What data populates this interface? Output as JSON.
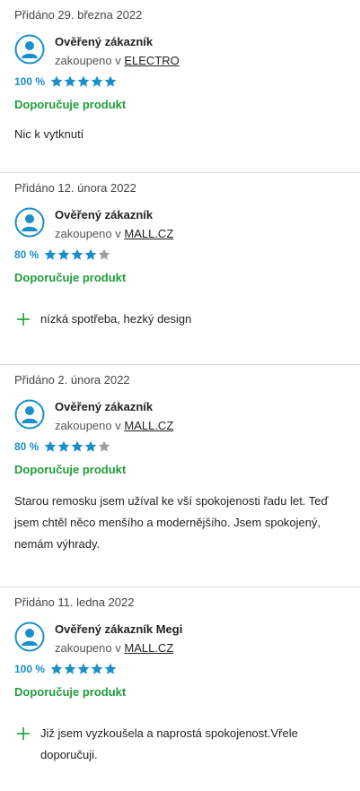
{
  "reviews": [
    {
      "date": "Přidáno 29. března 2022",
      "author": "Ověřený zákazník",
      "purchased_prefix": "zakoupeno v",
      "shop": "ELECTRO",
      "percent": "100 %",
      "rating_stars": 5,
      "recommend": "Doporučuje produkt",
      "text": "Nic k vytknutí"
    },
    {
      "date": "Přidáno 12. února 2022",
      "author": "Ověřený zákazník",
      "purchased_prefix": "zakoupeno v",
      "shop": "MALL.CZ",
      "percent": "80 %",
      "rating_stars": 4,
      "recommend": "Doporučuje produkt",
      "pro": "nízká spotřeba, hezký design"
    },
    {
      "date": "Přidáno 2. února 2022",
      "author": "Ověřený zákazník",
      "purchased_prefix": "zakoupeno v",
      "shop": "MALL.CZ",
      "percent": "80 %",
      "rating_stars": 4,
      "recommend": "Doporučuje produkt",
      "text": "Starou remosku jsem užíval ke vší spokojenosti řadu let. Teď jsem chtěl něco menšího a modernějšího. Jsem spokojený, nemám výhrady."
    },
    {
      "date": "Přidáno 11. ledna 2022",
      "author": "Ověřený zákazník Megi",
      "purchased_prefix": "zakoupeno v",
      "shop": "MALL.CZ",
      "percent": "100 %",
      "rating_stars": 5,
      "recommend": "Doporučuje produkt",
      "pro": "Již jsem vyzkoušela a naprostá spokojenost.Vřele doporučuji."
    }
  ],
  "colors": {
    "star_filled": "#1a8fc9",
    "star_empty": "#9e9e9e",
    "recommend": "#1f9d3a",
    "avatar": "#1a8fc9",
    "plus": "#1f9d3a"
  },
  "icons": [
    "user-avatar-icon",
    "star-icon",
    "plus-icon"
  ]
}
